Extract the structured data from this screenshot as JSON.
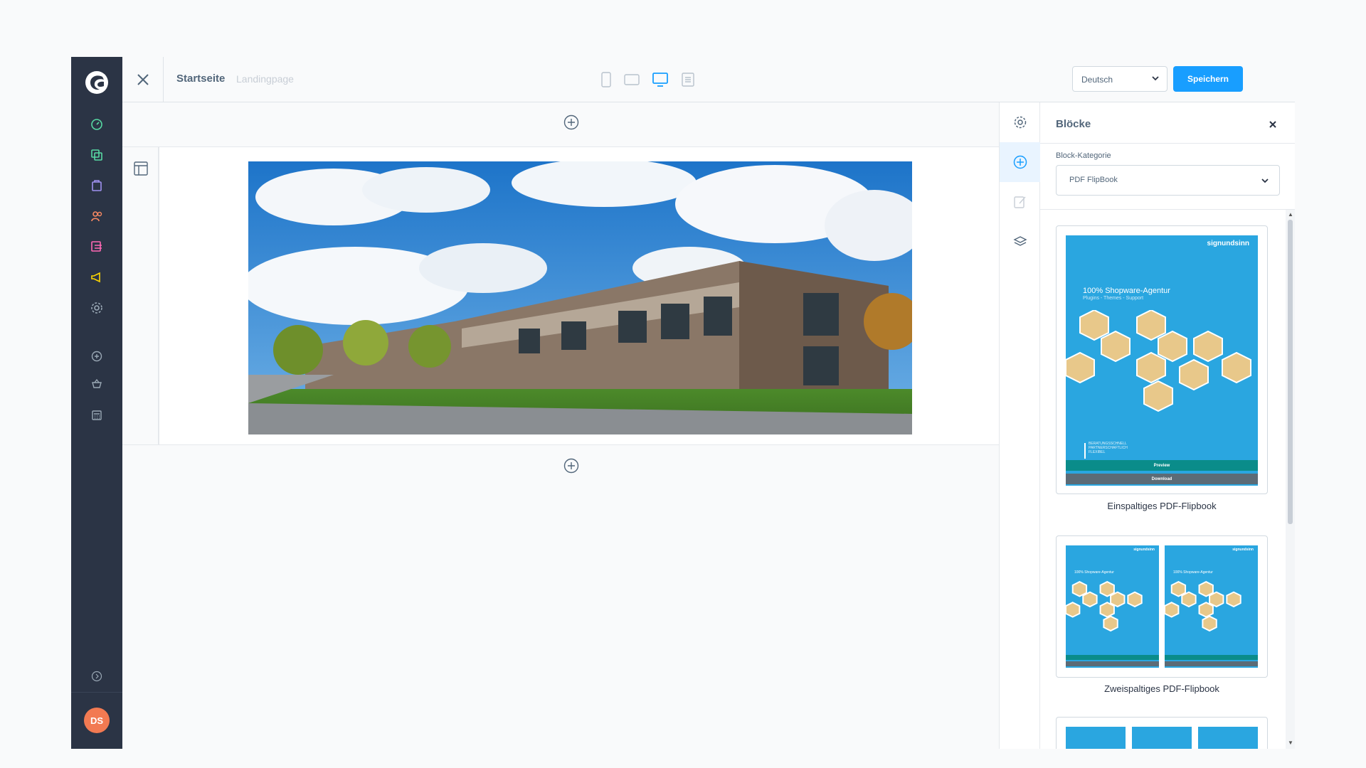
{
  "sidebar": {
    "items": [
      {
        "name": "dashboard",
        "color": "#57d9a3"
      },
      {
        "name": "catalogues",
        "color": "#57d9a3"
      },
      {
        "name": "orders",
        "color": "#a092f0"
      },
      {
        "name": "customers",
        "color": "#f88962"
      },
      {
        "name": "content",
        "color": "#ff68b4"
      },
      {
        "name": "marketing",
        "color": "#ffd700"
      },
      {
        "name": "settings",
        "color": "#9aa8b5"
      },
      {
        "name": "extensions",
        "color": "#9aa8b5"
      },
      {
        "name": "store",
        "color": "#9aa8b5"
      },
      {
        "name": "calculator",
        "color": "#9aa8b5"
      }
    ],
    "avatar_initials": "DS"
  },
  "topbar": {
    "title": "Startseite",
    "subtitle": "Landingpage",
    "language": "Deutsch",
    "save_label": "Speichern"
  },
  "panel": {
    "title": "Blöcke",
    "category_label": "Block-Kategorie",
    "category_value": "PDF FlipBook",
    "blocks": [
      {
        "label": "Einspaltiges PDF-Flipbook"
      },
      {
        "label": "Zweispaltiges PDF-Flipbook"
      }
    ],
    "preview": {
      "brand": "signundsinn",
      "headline": "100% Shopware-Agentur",
      "tagline": "Plugins - Themes - Support",
      "footer_lines": [
        "BERATUNGSSCHNELL",
        "PARTNERSCHAFTLICH",
        "FLEXIBEL"
      ],
      "preview_button": "Preview",
      "download_button": "Download"
    }
  },
  "colors": {
    "accent": "#189eff",
    "nav_bg": "#2b3445",
    "avatar": "#f27a52"
  }
}
